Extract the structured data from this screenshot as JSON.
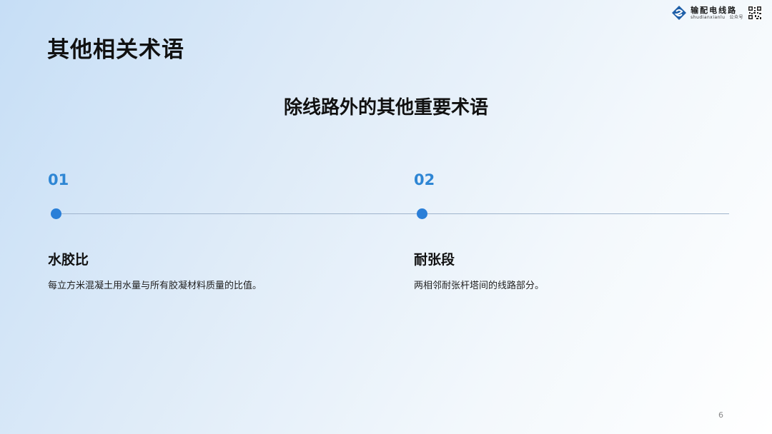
{
  "slide": {
    "title": "其他相关术语",
    "subtitle": "除线路外的其他重要术语",
    "page_number": "6"
  },
  "logo": {
    "name": "输配电线路",
    "romanized": "shudianxianlu",
    "tag": "公众号",
    "icon": "diamond-s-logo-icon"
  },
  "timeline": {
    "items": [
      {
        "number": "01",
        "term": "水胶比",
        "description": "每立方米混凝土用水量与所有胶凝材料质量的比值。"
      },
      {
        "number": "02",
        "term": "耐张段",
        "description": "两相邻耐张杆塔间的线路部分。"
      }
    ]
  },
  "colors": {
    "accent": "#2e86d4",
    "dot": "#2a7fd8",
    "line": "#9fb4cc",
    "text": "#111111"
  }
}
